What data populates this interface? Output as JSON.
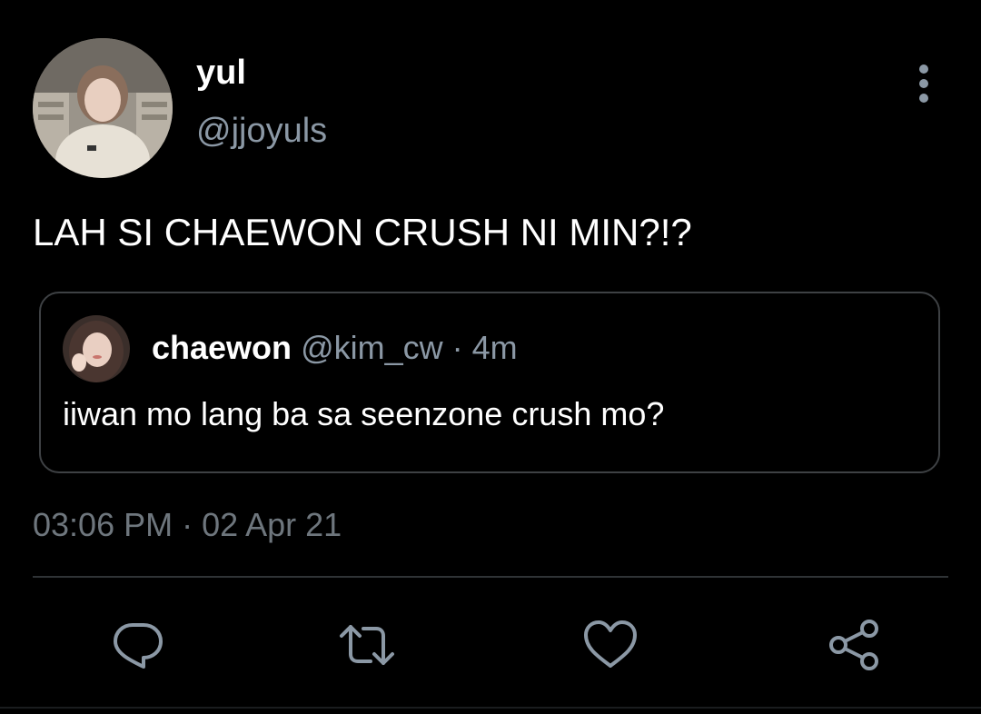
{
  "tweet": {
    "author": {
      "display_name": "yul",
      "handle": "@jjoyuls"
    },
    "text": "LAH SI CHAEWON CRUSH NI MIN?!?",
    "quoted_tweet": {
      "display_name": "chaewon",
      "handle": "@kim_cw",
      "separator": "·",
      "time_ago": "4m",
      "text": "iiwan mo lang ba sa seenzone crush mo?"
    },
    "timestamp": "03:06 PM · 02 Apr 21"
  },
  "icons": {
    "more": "more-vertical-icon",
    "reply": "reply-icon",
    "retweet": "retweet-icon",
    "like": "heart-icon",
    "share": "share-icon"
  },
  "colors": {
    "background": "#000000",
    "text_primary": "#ffffff",
    "text_secondary": "#8b98a5",
    "icon": "#8b98a5",
    "border": "#3e4144"
  }
}
